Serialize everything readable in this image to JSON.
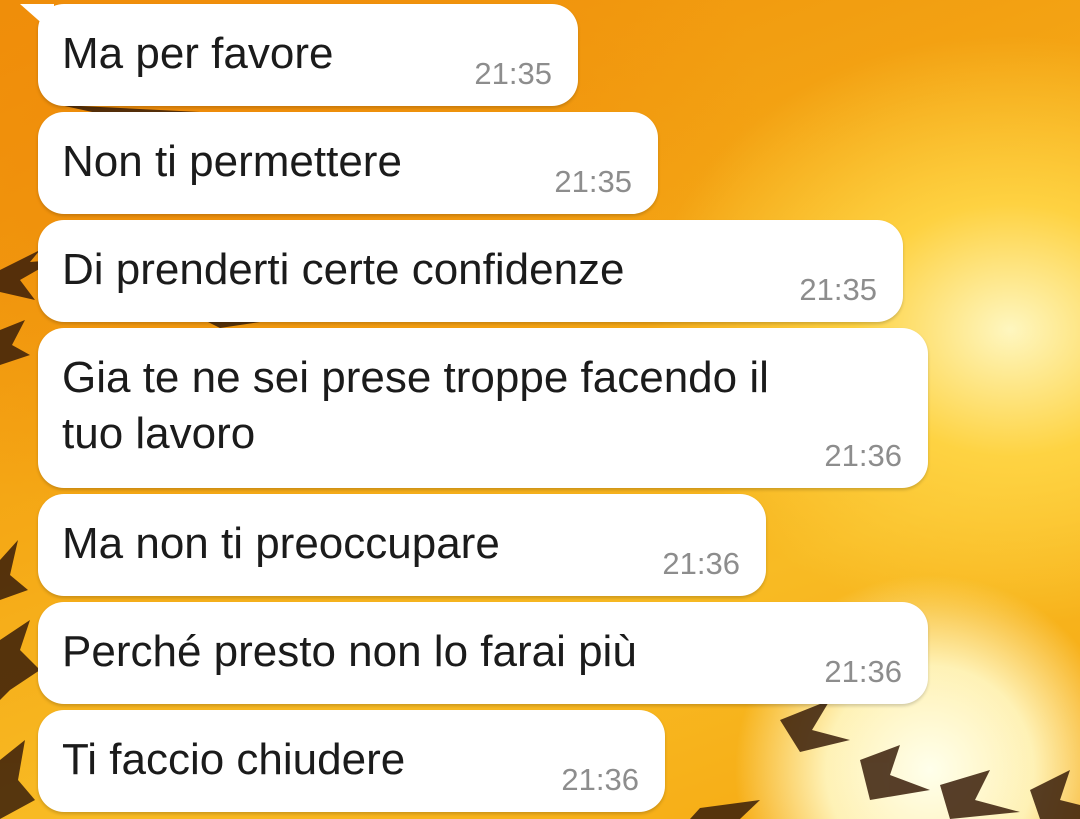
{
  "messages": [
    {
      "text": "Ma per favore",
      "time": "21:35"
    },
    {
      "text": "Non ti permettere",
      "time": "21:35"
    },
    {
      "text": "Di prenderti certe confidenze",
      "time": "21:35"
    },
    {
      "text": "Gia te ne sei prese troppe facendo il\ntuo lavoro",
      "time": "21:36"
    },
    {
      "text": "Ma non ti preoccupare",
      "time": "21:36"
    },
    {
      "text": "Perché presto non lo farai più",
      "time": "21:36"
    },
    {
      "text": "Ti faccio chiudere",
      "time": "21:36"
    }
  ],
  "wallpaper": {
    "base_color": "#f3a20c",
    "sun_color": "#fff8c8",
    "silhouette_color": "#3a1e0a"
  },
  "bubble_color": "#ffffff",
  "text_color": "#1b1b1b",
  "time_color": "#8d8d8d"
}
